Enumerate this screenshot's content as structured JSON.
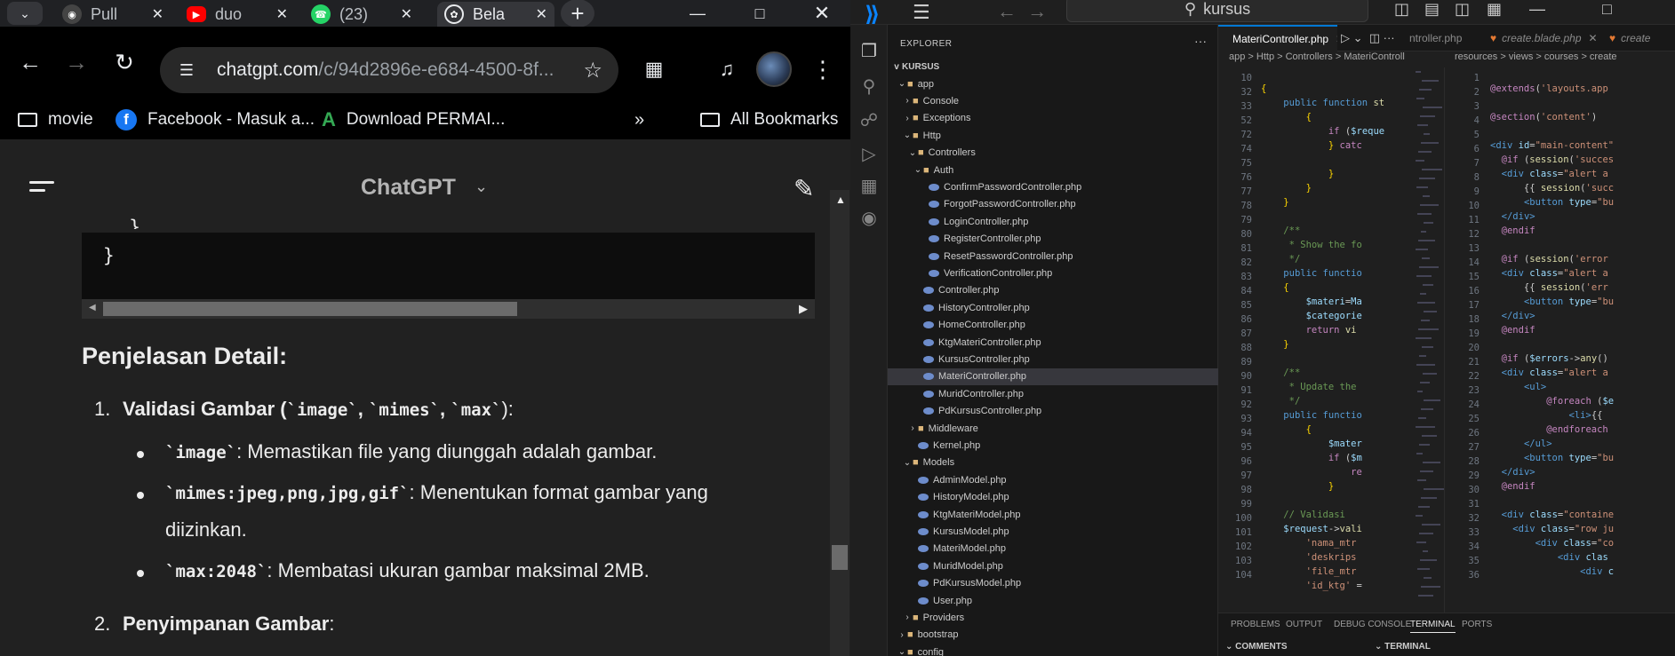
{
  "browser": {
    "tabs": [
      {
        "title": "Pull",
        "icon": "github-icon"
      },
      {
        "title": "duo",
        "icon": "youtube-icon"
      },
      {
        "title": "(23)",
        "icon": "whatsapp-icon"
      },
      {
        "title": "Bela",
        "icon": "chatgpt-icon"
      }
    ],
    "url_host": "chatgpt.com",
    "url_path": "/c/94d2896e-e684-4500-8f...",
    "bookmarks": [
      "movie",
      "Facebook - Masuk a...",
      "Download PERMAI...",
      "All Bookmarks"
    ]
  },
  "chatgpt": {
    "title": "ChatGPT",
    "code_close": "}",
    "heading": "Penjelasan Detail:",
    "items": [
      {
        "num": "1.",
        "title": "Validasi Gambar (",
        "code_a": "`image`",
        "sep1": ", ",
        "code_b": "`mimes`",
        "sep2": ", ",
        "code_c": "`max`",
        "tail": "):",
        "bullets": [
          {
            "code": "`image`",
            "text": ": Memastikan file yang diunggah adalah gambar."
          },
          {
            "code": "`mimes:jpeg,png,jpg,gif`",
            "text": ": Menentukan format gambar yang",
            "text2": "diizinkan."
          },
          {
            "code": "`max:2048`",
            "text": ": Membatasi ukuran gambar maksimal 2MB."
          }
        ]
      },
      {
        "num": "2.",
        "title": "Penyimpanan Gambar",
        "tail": ":"
      }
    ]
  },
  "vscode": {
    "search": "kursus",
    "explorer_title": "EXPLORER",
    "root": "KURSUS",
    "tree": [
      {
        "label": "app",
        "depth": 1,
        "type": "folder-open",
        "twisty": "v"
      },
      {
        "label": "Console",
        "depth": 2,
        "type": "folder",
        "twisty": ">"
      },
      {
        "label": "Exceptions",
        "depth": 2,
        "type": "folder",
        "twisty": ">"
      },
      {
        "label": "Http",
        "depth": 2,
        "type": "folder-open",
        "twisty": "v"
      },
      {
        "label": "Controllers",
        "depth": 3,
        "type": "folder-open",
        "twisty": "v"
      },
      {
        "label": "Auth",
        "depth": 4,
        "type": "folder-open",
        "twisty": "v"
      },
      {
        "label": "ConfirmPasswordController.php",
        "depth": 5,
        "type": "php"
      },
      {
        "label": "ForgotPasswordController.php",
        "depth": 5,
        "type": "php"
      },
      {
        "label": "LoginController.php",
        "depth": 5,
        "type": "php"
      },
      {
        "label": "RegisterController.php",
        "depth": 5,
        "type": "php"
      },
      {
        "label": "ResetPasswordController.php",
        "depth": 5,
        "type": "php"
      },
      {
        "label": "VerificationController.php",
        "depth": 5,
        "type": "php"
      },
      {
        "label": "Controller.php",
        "depth": 4,
        "type": "php"
      },
      {
        "label": "HistoryController.php",
        "depth": 4,
        "type": "php"
      },
      {
        "label": "HomeController.php",
        "depth": 4,
        "type": "php"
      },
      {
        "label": "KtgMateriController.php",
        "depth": 4,
        "type": "php"
      },
      {
        "label": "KursusController.php",
        "depth": 4,
        "type": "php"
      },
      {
        "label": "MateriController.php",
        "depth": 4,
        "type": "php",
        "selected": true
      },
      {
        "label": "MuridController.php",
        "depth": 4,
        "type": "php"
      },
      {
        "label": "PdKursusController.php",
        "depth": 4,
        "type": "php"
      },
      {
        "label": "Middleware",
        "depth": 3,
        "type": "folder",
        "twisty": ">"
      },
      {
        "label": "Kernel.php",
        "depth": 3,
        "type": "php"
      },
      {
        "label": "Models",
        "depth": 2,
        "type": "folder-open",
        "twisty": "v"
      },
      {
        "label": "AdminModel.php",
        "depth": 3,
        "type": "php"
      },
      {
        "label": "HistoryModel.php",
        "depth": 3,
        "type": "php"
      },
      {
        "label": "KtgMateriModel.php",
        "depth": 3,
        "type": "php"
      },
      {
        "label": "KursusModel.php",
        "depth": 3,
        "type": "php"
      },
      {
        "label": "MateriModel.php",
        "depth": 3,
        "type": "php"
      },
      {
        "label": "MuridModel.php",
        "depth": 3,
        "type": "php"
      },
      {
        "label": "PdKursusModel.php",
        "depth": 3,
        "type": "php"
      },
      {
        "label": "User.php",
        "depth": 3,
        "type": "php"
      },
      {
        "label": "Providers",
        "depth": 2,
        "type": "folder",
        "twisty": ">"
      },
      {
        "label": "bootstrap",
        "depth": 1,
        "type": "folder",
        "twisty": ">"
      },
      {
        "label": "config",
        "depth": 1,
        "type": "folder-open",
        "twisty": "v"
      }
    ],
    "tabs": {
      "left_active": "MateriController.php",
      "right_a": "ntroller.php",
      "right_b": "create.blade.php",
      "right_c": "create"
    },
    "crumb_left": "app > Http > Controllers > MateriControll",
    "crumb_right": "resources > views > courses > create",
    "left_lines": [
      "10",
      "32",
      "33",
      "52",
      "72",
      "74",
      "75",
      "76",
      "77",
      "78",
      "79",
      "80",
      "81",
      "82",
      "83",
      "84",
      "85",
      "86",
      "87",
      "88",
      "89",
      "90",
      "91",
      "92",
      "93",
      "94",
      "95",
      "96",
      "97",
      "98",
      "99",
      "100",
      "101",
      "102",
      "103",
      "104"
    ],
    "right_lines": [
      "1",
      "2",
      "3",
      "4",
      "5",
      "6",
      "7",
      "8",
      "9",
      "10",
      "11",
      "12",
      "13",
      "14",
      "15",
      "16",
      "17",
      "18",
      "19",
      "20",
      "21",
      "22",
      "23",
      "24",
      "25",
      "26",
      "27",
      "28",
      "29",
      "30",
      "31",
      "32",
      "33",
      "34",
      "35",
      "36"
    ],
    "panel_tabs": [
      "PROBLEMS",
      "OUTPUT",
      "DEBUG CONSOLE",
      "TERMINAL",
      "PORTS"
    ],
    "panel_sub": [
      "COMMENTS",
      "TERMINAL"
    ]
  }
}
